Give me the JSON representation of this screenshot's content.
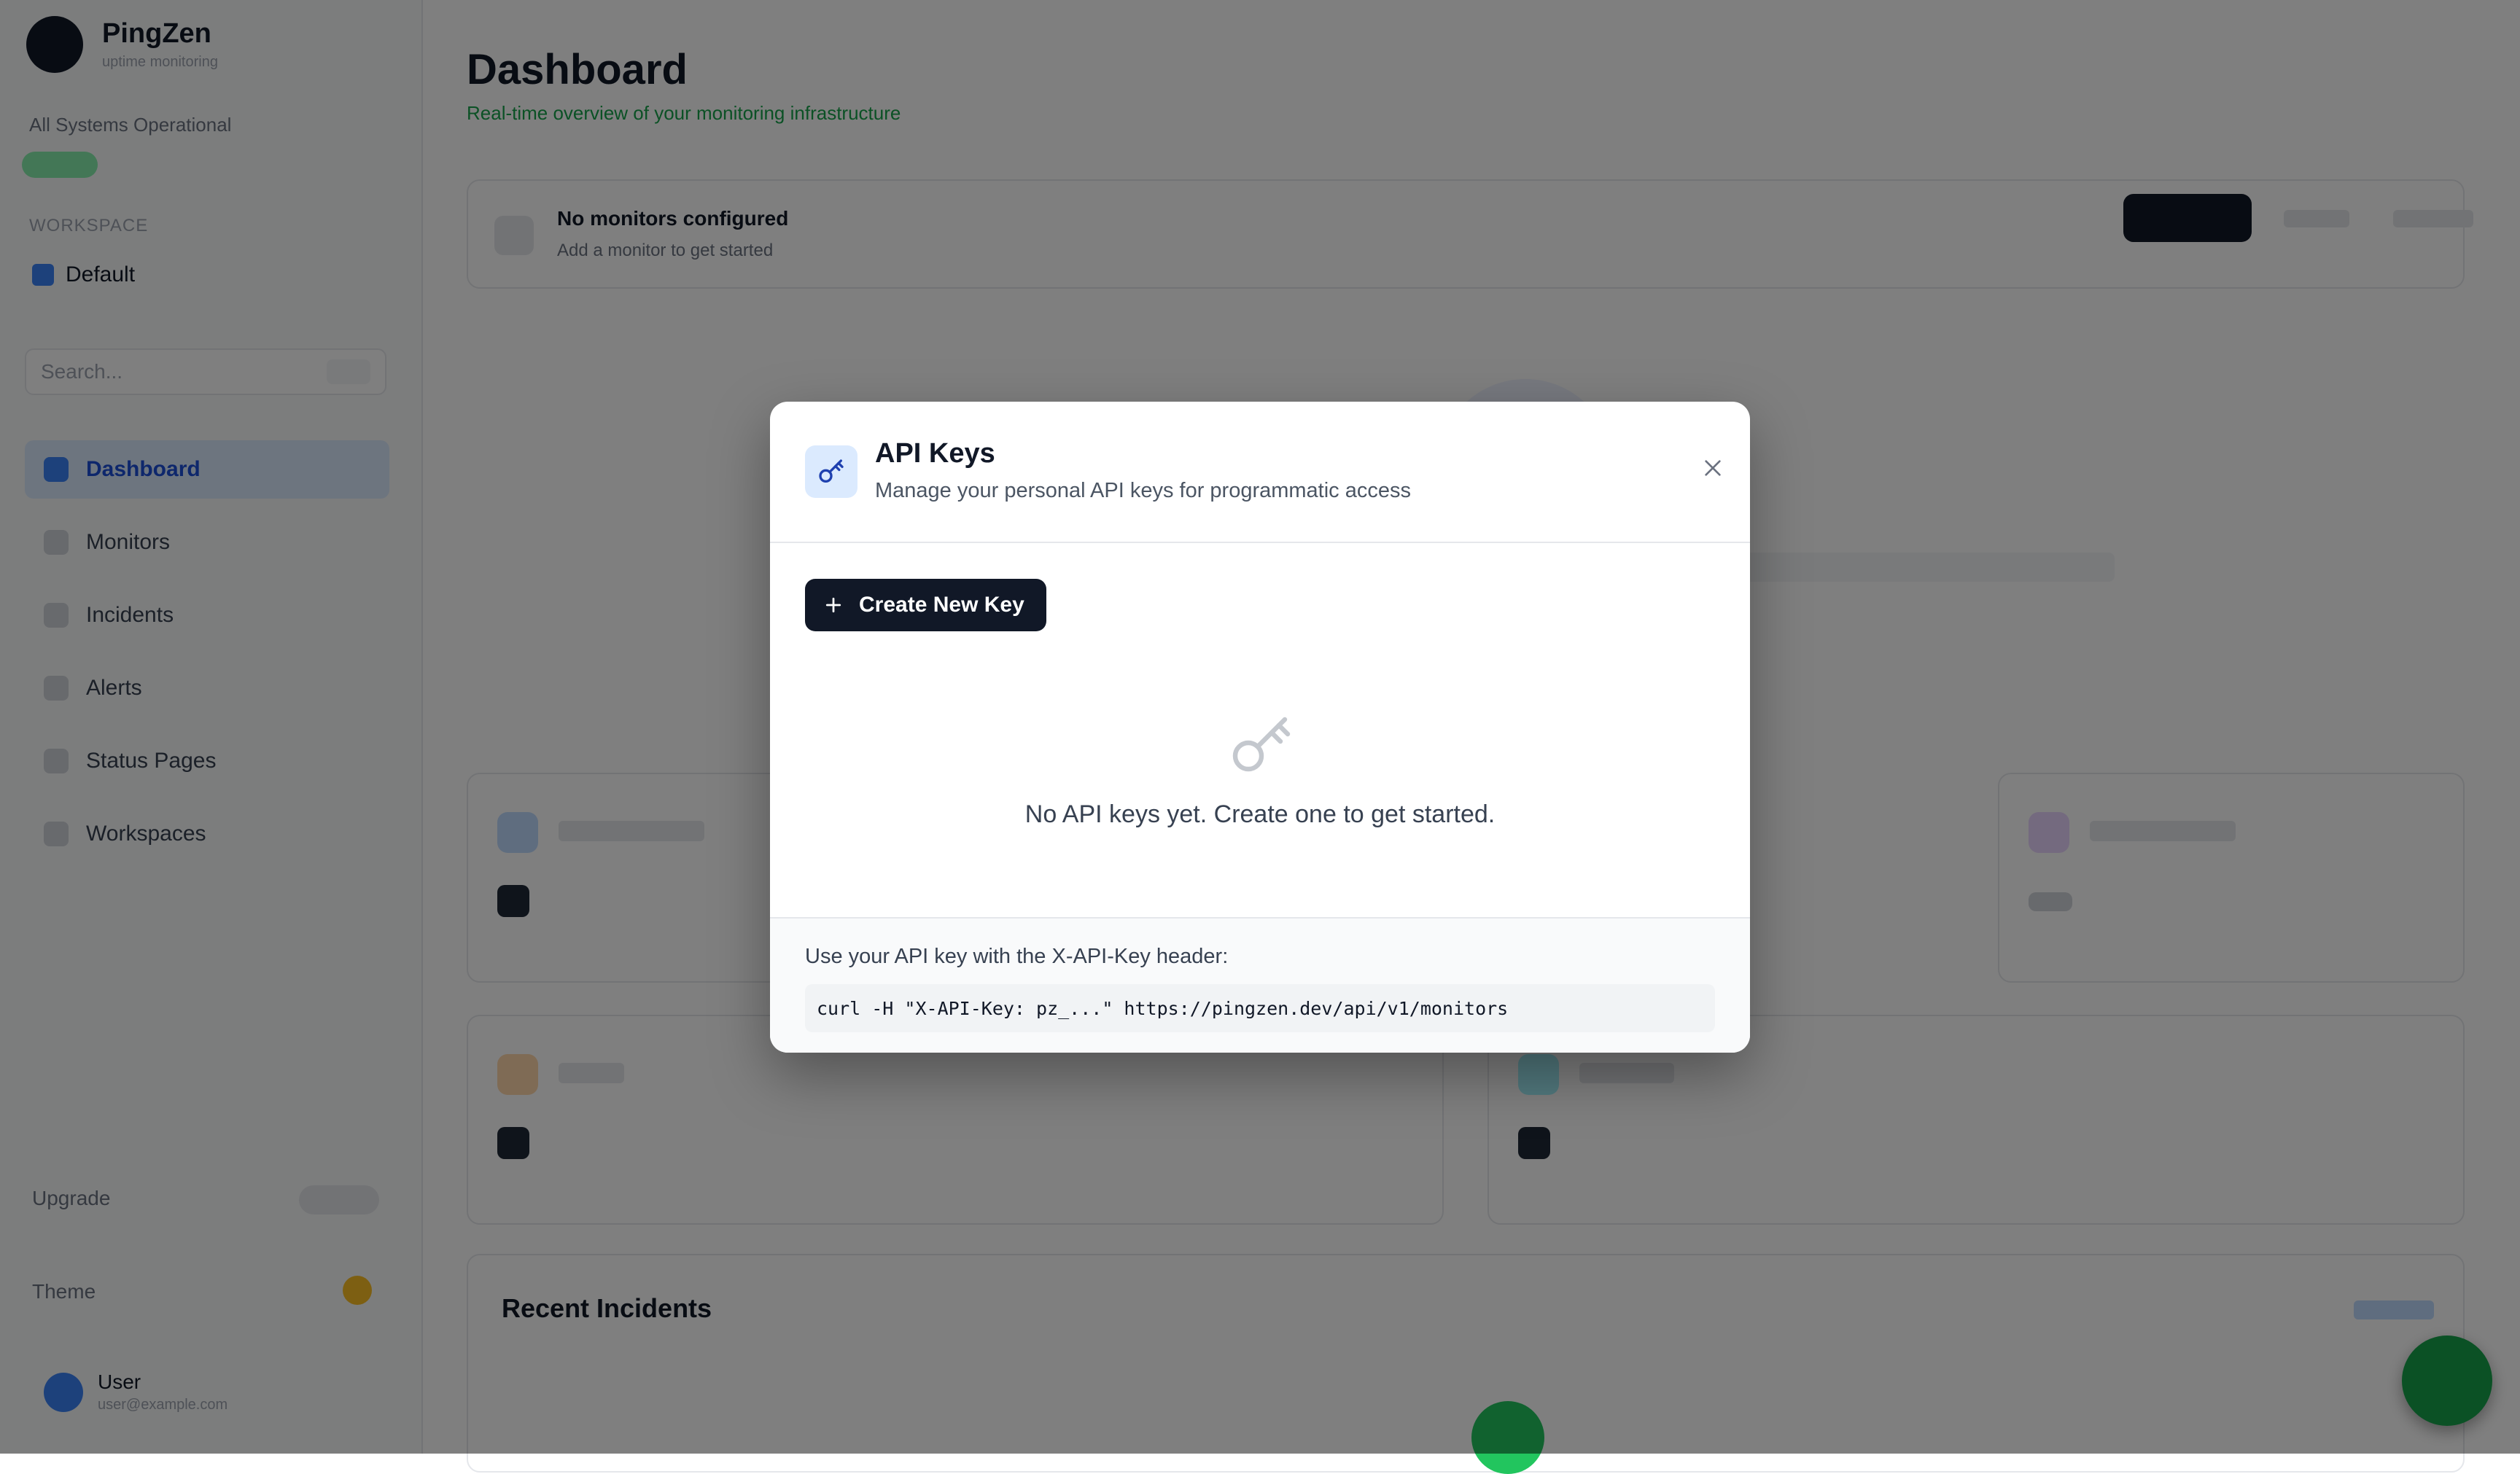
{
  "background": {
    "sidebar": {
      "brand_name": "PingZen",
      "brand_sub": "uptime monitoring",
      "status_text": "All Systems Operational",
      "section_label": "WORKSPACE",
      "workspace_name": "Default",
      "search_placeholder": "Search...",
      "nav_items": [
        "Dashboard",
        "Monitors",
        "Incidents",
        "Alerts",
        "Status Pages",
        "Workspaces"
      ],
      "bottom_item_1": "Upgrade",
      "bottom_item_2": "Theme",
      "user_name": "User",
      "user_email": "user@example.com"
    },
    "main": {
      "title": "Dashboard",
      "subtitle": "Real-time overview of your monitoring infrastructure",
      "banner_title": "No monitors configured",
      "banner_sub": "Add a monitor to get started",
      "incidents_title": "Recent Incidents"
    }
  },
  "modal": {
    "icon": "key-icon",
    "title": "API Keys",
    "subtitle": "Manage your personal API keys for programmatic access",
    "close_icon": "close-icon",
    "create_button": {
      "icon": "plus-icon",
      "label": "Create New Key"
    },
    "empty_state": {
      "icon": "key-icon",
      "text": "No API keys yet. Create one to get started."
    },
    "footer": {
      "label": "Use your API key with the X-API-Key header:",
      "code": "curl -H \"X-API-Key: pz_...\" https://pingzen.dev/api/v1/monitors"
    }
  },
  "colors": {
    "overlay": "rgba(0,0,0,0.5)",
    "primary_button": "#111827",
    "icon_accent": "#1e40af",
    "icon_bg": "#dbeafe",
    "empty_icon": "#c4c8ce"
  }
}
